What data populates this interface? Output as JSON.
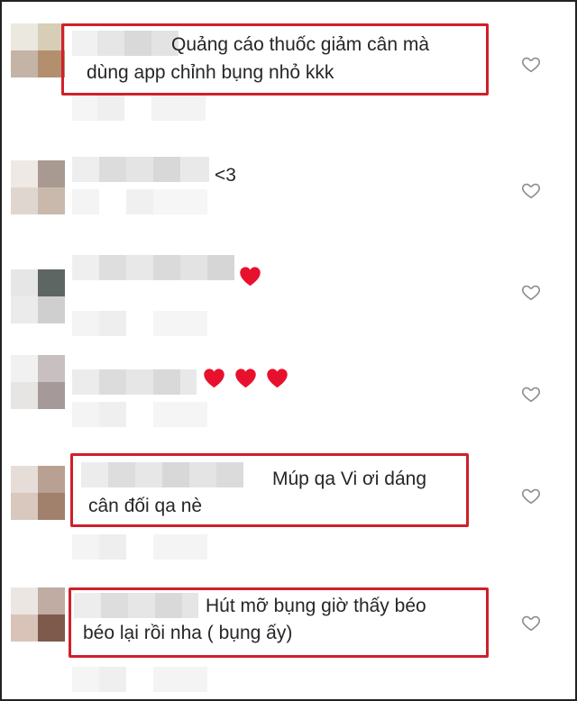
{
  "comments": [
    {
      "id": "c1",
      "text_line1": "Quảng cáo thuốc giảm cân mà",
      "text_line2": "dùng app chỉnh bụng nhỏ kkk",
      "highlighted": true
    },
    {
      "id": "c2",
      "text_line1": "<3",
      "text_line2": "",
      "highlighted": false
    },
    {
      "id": "c3",
      "text_line1": "",
      "text_line2": "",
      "emoji_count": 1,
      "highlighted": false
    },
    {
      "id": "c4",
      "text_line1": "",
      "text_line2": "",
      "emoji_count": 3,
      "highlighted": false
    },
    {
      "id": "c5",
      "text_line1": "Múp qa Vi ơi dáng",
      "text_line2": "cân đối qa nè",
      "highlighted": true
    },
    {
      "id": "c6",
      "text_line1": "Hút mỡ bụng giờ thấy béo",
      "text_line2": "béo lại rồi nha ( bụng ấy)",
      "highlighted": true
    }
  ],
  "icons": {
    "like": "heart-outline-icon",
    "emoji": "red-heart-emoji"
  },
  "colors": {
    "highlight": "#d0202a",
    "emoji_heart": "#e8112d",
    "like_stroke": "#8e8e8e",
    "text": "#262626"
  }
}
